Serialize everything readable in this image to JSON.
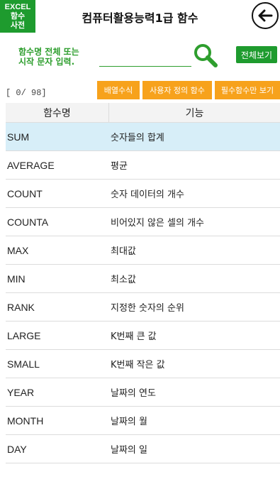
{
  "header": {
    "logo_lines": [
      "EXCEL",
      "함수",
      "사전"
    ],
    "title": "컴퓨터활용능력1급 함수"
  },
  "search": {
    "hint_line1": "함수명 전체 또는",
    "hint_line2": "시작 문자 입력.",
    "value": "",
    "placeholder": "",
    "show_all_label": "전체보기"
  },
  "counter": "[ 0/ 98]",
  "filters": {
    "array_label": "배열수식",
    "user_defined_label": "사용자 정의 함수",
    "required_only_label": "필수함수만 보기"
  },
  "table": {
    "headers": [
      "함수명",
      "기능"
    ],
    "rows": [
      {
        "name": "SUM",
        "desc": "숫자들의 합계"
      },
      {
        "name": "AVERAGE",
        "desc": "평균"
      },
      {
        "name": "COUNT",
        "desc": "숫자 데이터의 개수"
      },
      {
        "name": "COUNTA",
        "desc": "비어있지 않은 셀의 개수"
      },
      {
        "name": "MAX",
        "desc": "최대값"
      },
      {
        "name": "MIN",
        "desc": "최소값"
      },
      {
        "name": "RANK",
        "desc": "지정한 숫자의 순위"
      },
      {
        "name": "LARGE",
        "desc": "K번째 큰 값"
      },
      {
        "name": "SMALL",
        "desc": "K번째 작은 값"
      },
      {
        "name": "YEAR",
        "desc": "날짜의 연도"
      },
      {
        "name": "MONTH",
        "desc": "날짜의 월"
      },
      {
        "name": "DAY",
        "desc": "날짜의 일"
      }
    ]
  },
  "icons": {
    "back": "arrow-left-icon",
    "search": "magnifier-icon"
  },
  "colors": {
    "brand_green": "#1e9b2e",
    "hint_green": "#2e9e2e",
    "filter_orange": "#f7a21c",
    "selected_row": "#d7eef8"
  }
}
